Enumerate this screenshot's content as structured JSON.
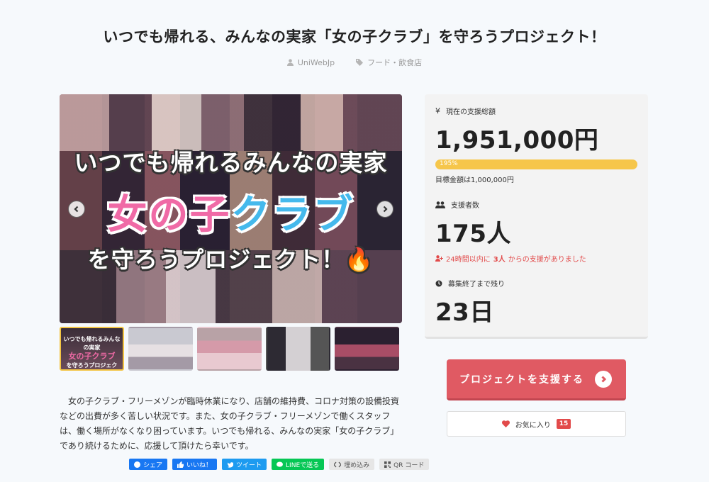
{
  "page": {
    "title": "いつでも帰れる、みんなの実家「女の子クラブ」を守ろうプロジェクト！",
    "author": "UniWebJp",
    "category": "フード・飲食店"
  },
  "hero": {
    "line1": "いつでも帰れるみんなの実家",
    "line2_pink": "女の子",
    "line2_blue": "クラブ",
    "line3": "を守ろうプロジェクト！🔥"
  },
  "thumb1": {
    "line1": "いつでも帰れるみんなの実家",
    "line2": "女の子クラブ",
    "line3": "を守ろうプロジェクト！"
  },
  "description": "女の子クラブ・フリーメゾンが臨時休業になり、店舗の維持費、コロナ対策の設備投資などの出費が多く苦しい状況です。また、女の子クラブ・フリーメゾンで働くスタッフは、働く場所がなくなり困っています。いつでも帰れる、みんなの実家「女の子クラブ」であり続けるために、応援して頂けたら幸いです。",
  "share": {
    "facebook": "シェア",
    "like": "いいね！",
    "tweet": "ツイート",
    "line": "LINEで送る",
    "embed": "埋め込み",
    "qr": "QR コード"
  },
  "stats": {
    "total_label": "現在の支援総額",
    "total": "1,951,000円",
    "progress_text": "195%",
    "progress_percent": 195,
    "goal": "目標金額は1,000,000円",
    "backers_label": "支援者数",
    "backers": "175人",
    "recent_prefix": "24時間以内に",
    "recent_count": "3人",
    "recent_suffix": "からの支援がありました",
    "remaining_label": "募集終了まで残り",
    "remaining": "23日"
  },
  "actions": {
    "support": "プロジェクトを支援する",
    "favorite": "お気に入り",
    "favorite_count": "15"
  },
  "colors": {
    "accent_red": "#e05a63",
    "progress": "#f6c64a",
    "thumb_active": "#f3c544"
  }
}
